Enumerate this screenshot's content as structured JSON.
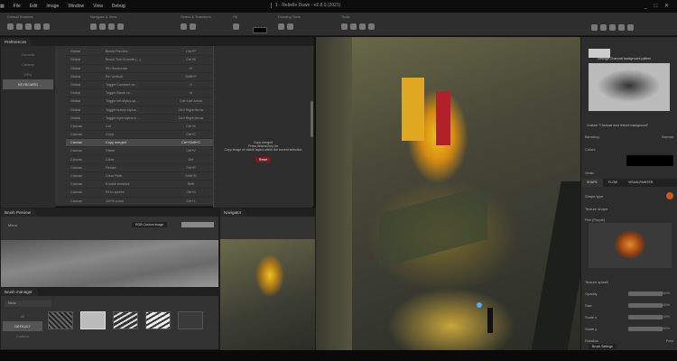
{
  "menu": [
    "File",
    "Edit",
    "Image",
    "Window",
    "View",
    "Debug"
  ],
  "window_title": "1 - Rebelle Dawn - v2.8.0 (2021)",
  "window_controls": "_ □ ✕",
  "toolbar": {
    "groups": [
      "Default Brushes",
      "Navigate & View",
      "Select & Transform",
      "Fill",
      "Drawing Tools",
      "Tools"
    ]
  },
  "prefs": {
    "tab": "Preferences",
    "side": [
      "General",
      "Canvas",
      "GPU",
      "KEYBOARD"
    ],
    "headers": [
      "Group",
      "Action",
      "Shortcut"
    ],
    "rows": [
      [
        "Global",
        "Brush Preview",
        "Ctrl+P"
      ],
      [
        "Global",
        "Brush Tool Smooth (...)",
        "Ctrl+B"
      ],
      [
        "Global",
        "Pin Horizontal",
        "H"
      ],
      [
        "Global",
        "Pin Vertical",
        "Shift+P"
      ],
      [
        "Global",
        "Toggle Constant ve...",
        "V"
      ],
      [
        "Global",
        "Toggle Blank ve...",
        "N"
      ],
      [
        "Global",
        "Toggle left stylus sp...",
        "Ctrl+Left Arrow"
      ],
      [
        "Global",
        "Toggle button stylus...",
        "Ctrl+Right Arrow"
      ],
      [
        "Global",
        "Toggle right stylus e...",
        "Ctrl+Right Arrow"
      ],
      [
        "Canvas",
        "Cut",
        "Ctrl+X"
      ],
      [
        "Canvas",
        "Copy",
        "Ctrl+C"
      ],
      [
        "Canvas",
        "Copy merged",
        "Ctrl+Shift+C"
      ],
      [
        "Canvas",
        "Paste",
        "Ctrl+V"
      ],
      [
        "Canvas",
        "Clear",
        "Del"
      ],
      [
        "Canvas",
        "Resize",
        "Ctrl+R"
      ],
      [
        "Canvas",
        "Clear Path",
        "Shift+D"
      ],
      [
        "Canvas",
        "Enable brushes",
        "Shift"
      ],
      [
        "Canvas",
        "Fit to screen",
        "Ctrl+0"
      ],
      [
        "Canvas",
        "100% zoom",
        "Ctrl+1"
      ]
    ],
    "selected_row": 11,
    "desc_title": "Copy merged",
    "desc_sub": "Press desired key for",
    "desc_text": "Copy image of visible layers within the current selection",
    "desc_button": "Reset"
  },
  "brush_preview": {
    "tab": "Brush Preview",
    "menu": "Menu",
    "select": "RGB Custom image"
  },
  "navigator": {
    "tab": "Navigator"
  },
  "brush_manager": {
    "tab": "Brush manager",
    "search": "Menu",
    "side": [
      "All",
      "DEFAULT",
      "Custom"
    ]
  },
  "right": {
    "brush_name": "Smudge Charcoal background pattern",
    "texture": "Custom \"Charcoal dust texture background\"",
    "blending": "Blending",
    "blending_mode": "Normal",
    "colors": "Colors",
    "grain": "Grain",
    "tabs": [
      "SHAPE",
      "FLOW",
      "VISUALPAINTER"
    ],
    "shape_type": "Shape type",
    "texture_shape": "Texture shape",
    "shape_file": "Fire (Purple)",
    "texture_splash": "Texture splash",
    "sliders": [
      {
        "label": "Opacity",
        "value": "100%"
      },
      {
        "label": "Size",
        "value": "100%"
      },
      {
        "label": "Scale x",
        "value": "100%"
      },
      {
        "label": "Scale y",
        "value": "100%"
      }
    ],
    "rotation": "Rotation",
    "rotation_value": "Free",
    "bottom_tab": "Brush Settings"
  },
  "colors": {
    "accent": "#7a1a22",
    "panel": "#333333"
  }
}
